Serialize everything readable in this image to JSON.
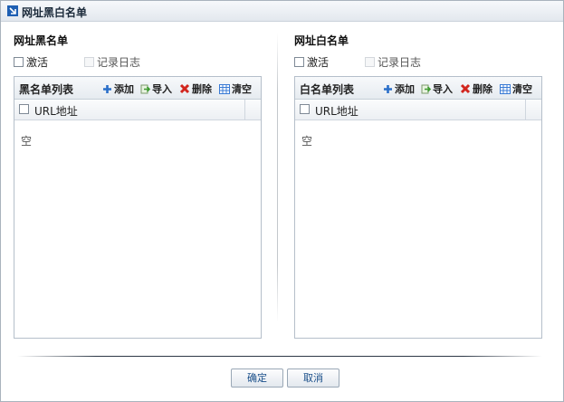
{
  "window": {
    "title": "网址黑白名单"
  },
  "blacklist": {
    "section_title": "网址黑名单",
    "activate_label": "激活",
    "log_label": "记录日志",
    "list_title": "黑名单列表",
    "toolbar": {
      "add": "添加",
      "import": "导入",
      "delete": "删除",
      "clear": "清空"
    },
    "column_header": "URL地址",
    "empty_text": "空"
  },
  "whitelist": {
    "section_title": "网址白名单",
    "activate_label": "激活",
    "log_label": "记录日志",
    "list_title": "白名单列表",
    "toolbar": {
      "add": "添加",
      "import": "导入",
      "delete": "删除",
      "clear": "清空"
    },
    "column_header": "URL地址",
    "empty_text": "空"
  },
  "footer": {
    "ok_label": "确定",
    "cancel_label": "取消"
  },
  "icons": {
    "title": "arrow-corner-icon",
    "add": "plus-icon",
    "import": "import-icon",
    "delete": "delete-x-icon",
    "clear": "grid-clear-icon"
  },
  "colors": {
    "add": "#2a6fc9",
    "import": "#3c9a2e",
    "delete": "#d2261e",
    "clear": "#3a7bd5",
    "button_text": "#1a4f8a"
  }
}
